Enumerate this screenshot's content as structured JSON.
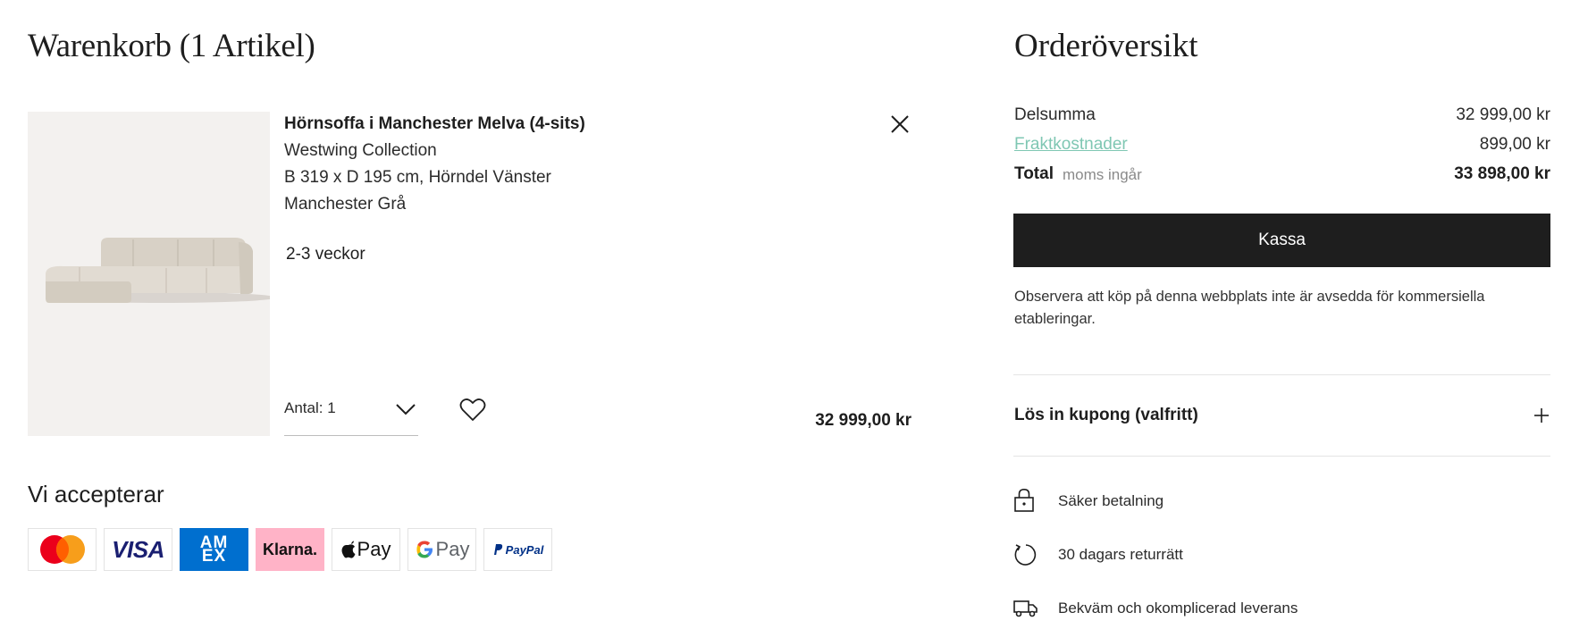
{
  "cart": {
    "title": "Warenkorb (1 Artikel)",
    "item": {
      "name": "Hörnsoffa i Manchester Melva (4-sits)",
      "brand": "Westwing Collection",
      "dimensions": "B 319 x D 195 cm, Hörndel Vänster",
      "color": "Manchester Grå",
      "delivery_time": "2-3 veckor",
      "quantity_label": "Antal: 1",
      "price": "32 999,00 kr",
      "image_icon": "corner-sofa-image"
    }
  },
  "payments": {
    "heading": "Vi accepterar",
    "methods": [
      {
        "name": "Mastercard",
        "icon": "mastercard-logo"
      },
      {
        "name": "VISA",
        "icon": "visa-logo"
      },
      {
        "name": "AMEX",
        "icon": "amex-logo"
      },
      {
        "name": "Klarna.",
        "icon": "klarna-logo"
      },
      {
        "name": "Pay",
        "icon": "apple-pay-logo"
      },
      {
        "name": "Pay",
        "icon": "google-pay-logo"
      },
      {
        "name": "PayPal",
        "icon": "paypal-logo"
      }
    ]
  },
  "summary": {
    "title": "Orderöversikt",
    "subtotal_label": "Delsumma",
    "subtotal_value": "32 999,00 kr",
    "shipping_label": "Fraktkostnader",
    "shipping_value": "899,00 kr",
    "total_label": "Total",
    "vat_note": "moms ingår",
    "total_value": "33 898,00 kr",
    "checkout_label": "Kassa",
    "notice": "Observera att köp på denna webbplats inte är avsedda för kommersiella etableringar.",
    "coupon_label": "Lös in kupong (valfritt)"
  },
  "features": {
    "secure_payment": "Säker betalning",
    "returns": "30 dagars returrätt",
    "delivery": "Bekväm och okomplicerad leverans"
  },
  "colors": {
    "accent_link": "#7fc7b3",
    "checkout_bg": "#1e1e1e",
    "klarna_pink": "#ffb3c7",
    "amex_blue": "#006fcf",
    "visa_blue": "#1a1f71"
  }
}
